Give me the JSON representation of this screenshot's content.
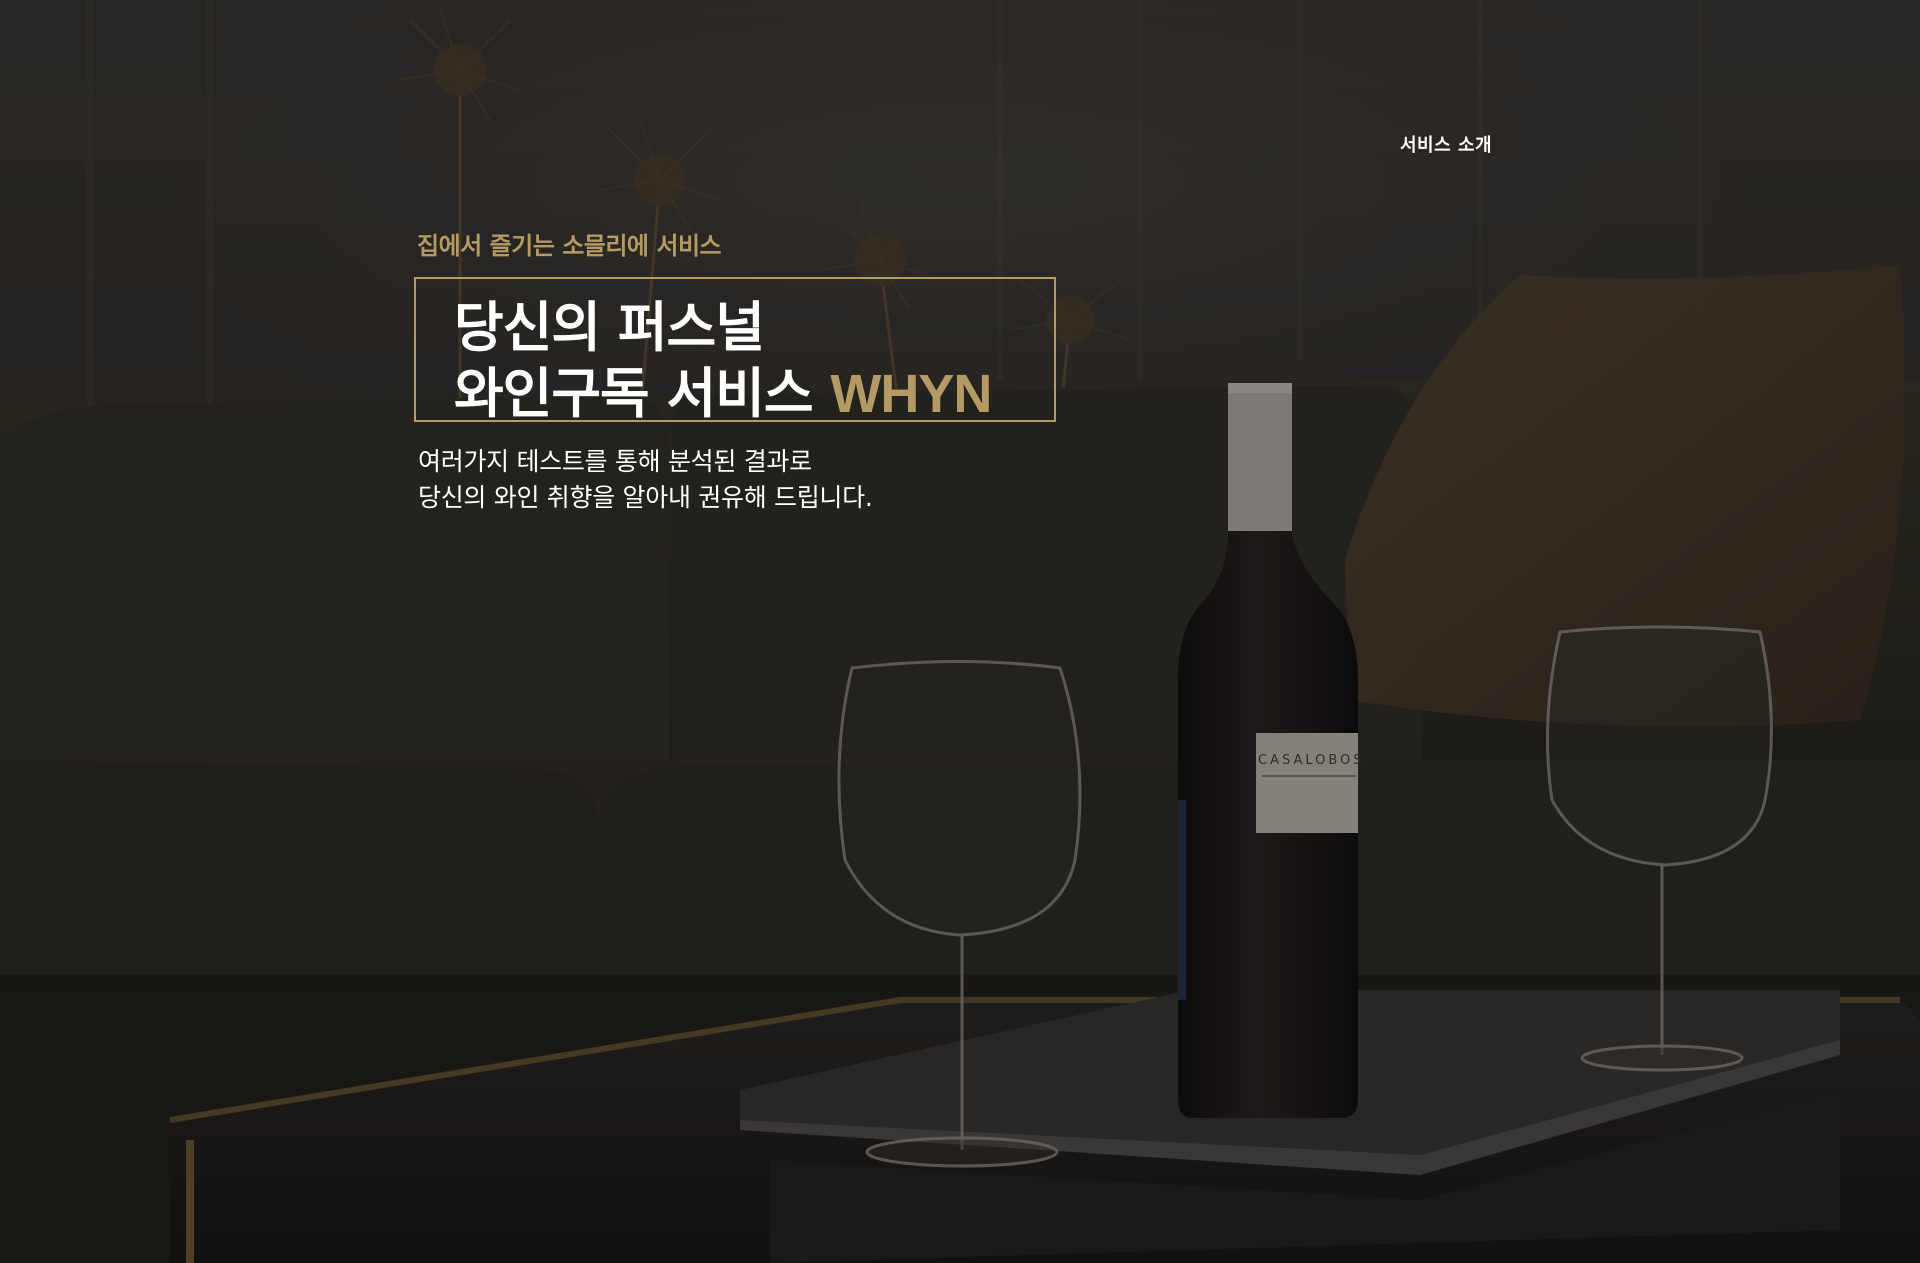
{
  "nav": {
    "service_intro": "서비스 소개"
  },
  "hero": {
    "eyebrow": "집에서 즐기는 소믈리에 서비스",
    "title_line1": "당신의 퍼스널",
    "title_line2_prefix": "와인구독 서비스 ",
    "title_brand": "WHYN",
    "description_line1": "여러가지 테스트를 통해 분석된 결과로",
    "description_line2": "당신의 와인 취향을 알아내 권유해 드립니다."
  },
  "background": {
    "label_text": "CASALOBOS",
    "accent_color": "#b49a64"
  }
}
